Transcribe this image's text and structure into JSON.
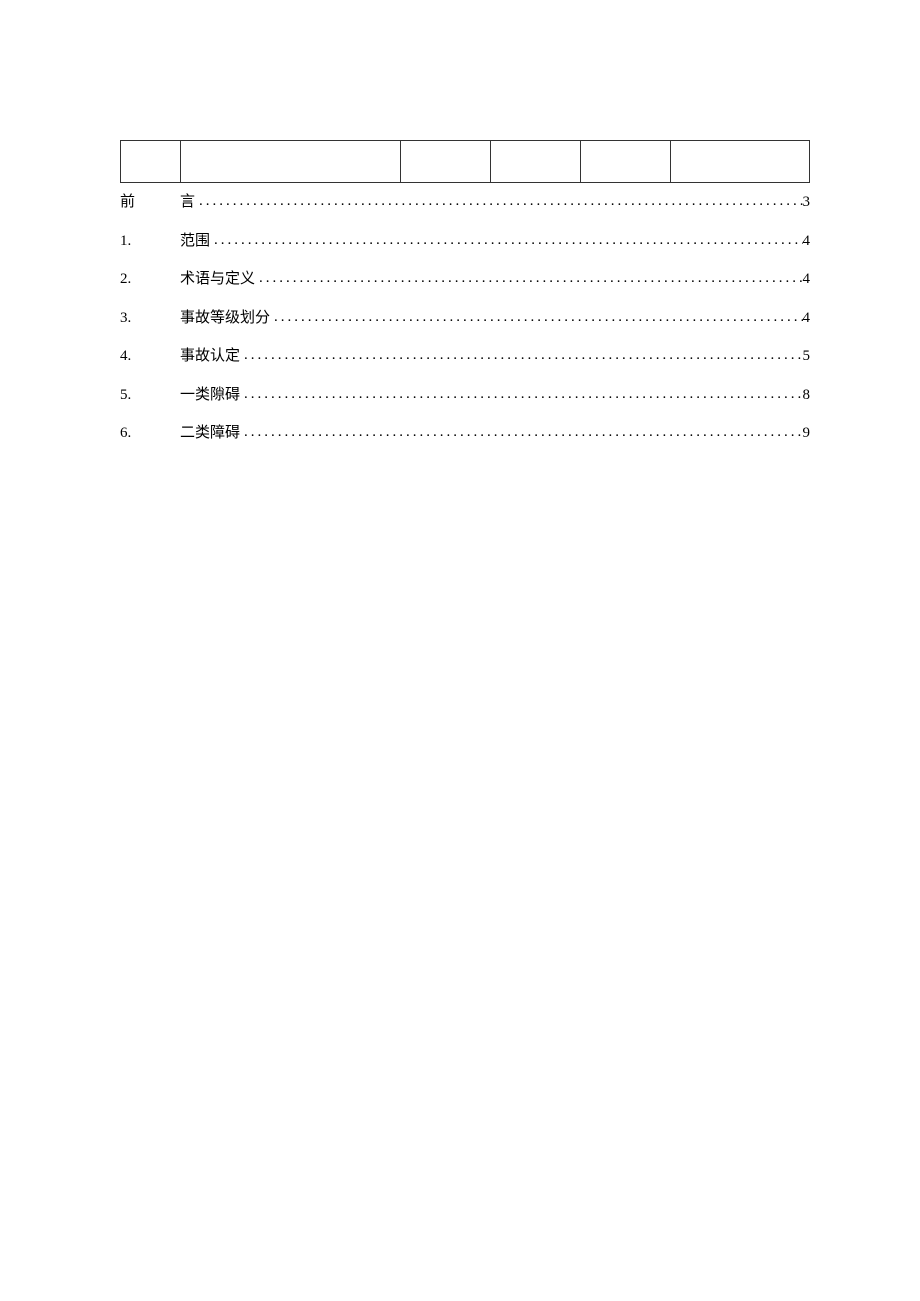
{
  "toc": [
    {
      "num": "前",
      "title": "言",
      "page": "3"
    },
    {
      "num": "1.",
      "title": "范围",
      "page": "4"
    },
    {
      "num": "2.",
      "title": "术语与定义",
      "page": "4"
    },
    {
      "num": "3.",
      "title": "事故等级划分",
      "page": "4"
    },
    {
      "num": "4.",
      "title": "事故认定",
      "page": "5"
    },
    {
      "num": "5.",
      "title": "一类隙碍",
      "page": "8"
    },
    {
      "num": "6.",
      "title": "二类障碍",
      "page": "9"
    }
  ]
}
